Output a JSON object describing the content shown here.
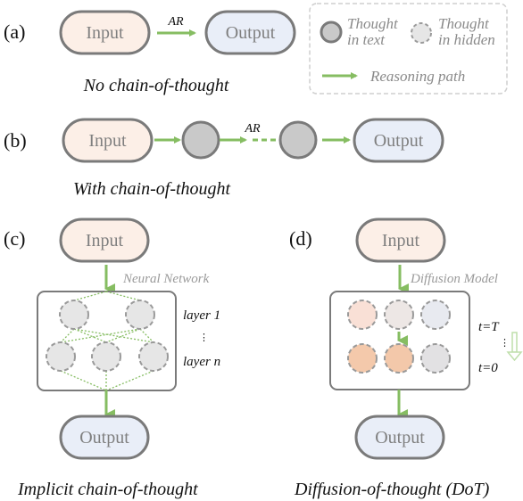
{
  "colors": {
    "input_fill": "#fcefe7",
    "output_fill": "#e9eef8",
    "border": "#7a7a7a",
    "thought_text_fill": "#c9c9c9",
    "thought_hidden_fill": "#e6e6e6",
    "hidden_border": "#9a9a9a",
    "arrow": "#86bd62",
    "arrow_light": "#bfdfab",
    "legend_border": "#cfcfcf",
    "diffusion_top": [
      "#f9e0d6",
      "#ede7e5",
      "#e8eaf0"
    ],
    "diffusion_bottom": [
      "#f4c9ab",
      "#f3c8aa",
      "#e2e1e3"
    ]
  },
  "legend": {
    "thought_in_text": [
      "Thought",
      "in text"
    ],
    "thought_in_hidden": [
      "Thought",
      "in hidden"
    ],
    "reasoning_path": "Reasoning path"
  },
  "panels": {
    "a": {
      "label": "(a)",
      "input": "Input",
      "output": "Output",
      "arrow_label": "AR",
      "caption": "No chain-of-thought"
    },
    "b": {
      "label": "(b)",
      "input": "Input",
      "output": "Output",
      "arrow_label": "AR",
      "caption": "With chain-of-thought"
    },
    "c": {
      "label": "(c)",
      "input": "Input",
      "output": "Output",
      "model_label": "Neural Network",
      "layer_first": "layer 1",
      "layer_ellipsis": "⋮",
      "layer_last": "layer n",
      "caption": "Implicit chain-of-thought"
    },
    "d": {
      "label": "(d)",
      "input": "Input",
      "output": "Output",
      "model_label": "Diffusion Model",
      "t_start": "t=T",
      "t_ellipsis": "⋮",
      "t_end": "t=0",
      "caption": "Diffusion-of-thought (DoT)"
    }
  }
}
